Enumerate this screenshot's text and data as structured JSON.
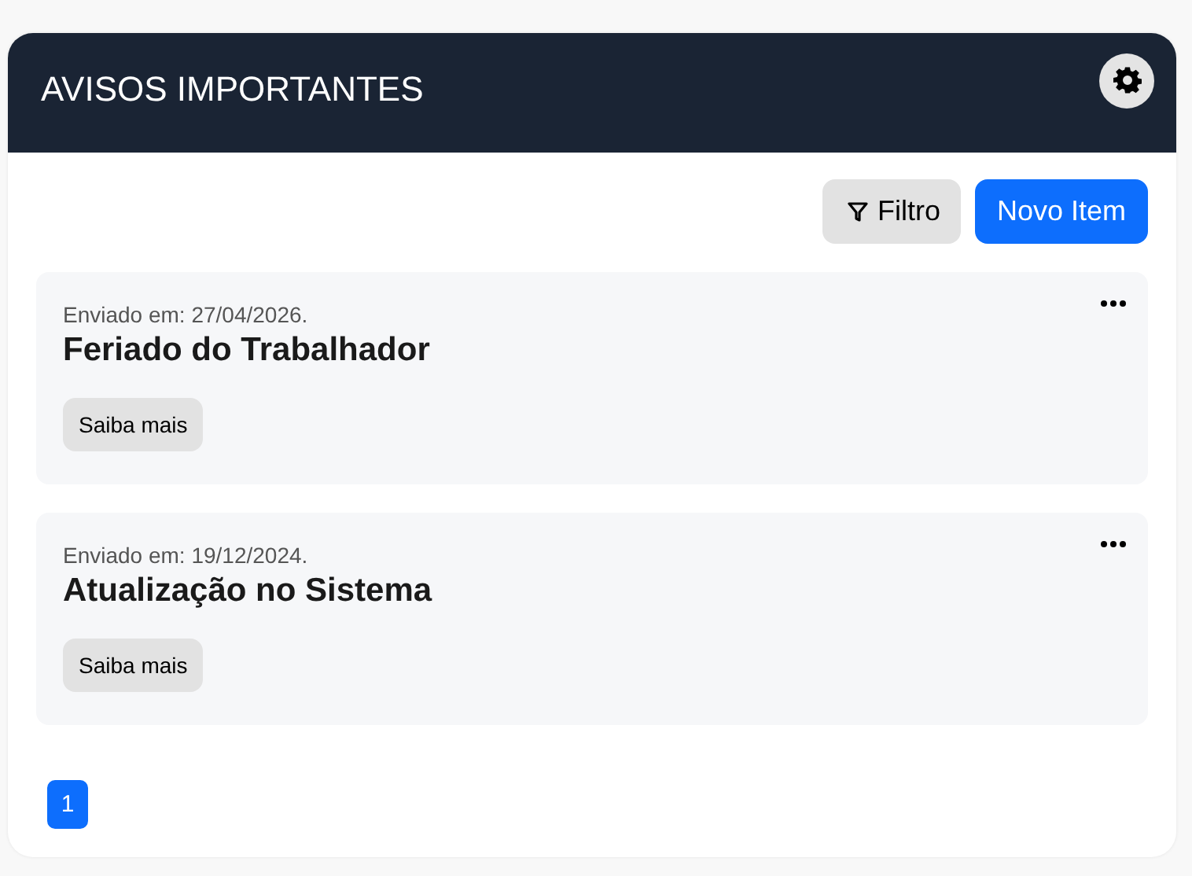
{
  "header": {
    "title": "AVISOS IMPORTANTES"
  },
  "toolbar": {
    "filter_button": "Filtro",
    "new_button": "Novo Item"
  },
  "notices": [
    {
      "sent": "Enviado em: 27/04/2026.",
      "title": "Feriado do Trabalhador",
      "more": "Saiba mais"
    },
    {
      "sent": "Enviado em: 19/12/2024.",
      "title": "Atualização no Sistema",
      "more": "Saiba mais"
    }
  ],
  "pagination": [
    {
      "label": "1",
      "selected": true
    }
  ]
}
